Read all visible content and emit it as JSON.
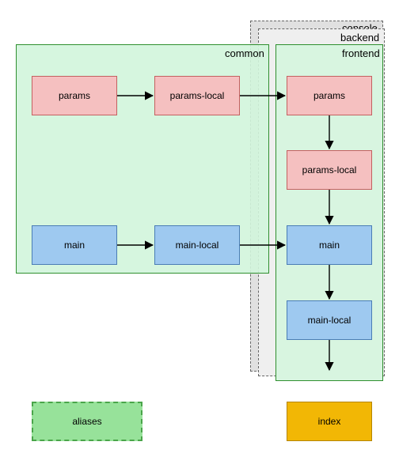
{
  "stack_labels": {
    "console": "console",
    "backend": "backend"
  },
  "containers": {
    "common": "common",
    "frontend": "frontend"
  },
  "common": {
    "params": "params",
    "params_local": "params-local",
    "main": "main",
    "main_local": "main-local"
  },
  "frontend": {
    "params": "params",
    "params_local": "params-local",
    "main": "main",
    "main_local": "main-local"
  },
  "footer": {
    "aliases": "aliases",
    "index": "index"
  },
  "chart_data": {
    "type": "diagram",
    "groups": [
      {
        "id": "common",
        "label": "common",
        "nodes": [
          "cp",
          "cpl",
          "cm",
          "cml"
        ]
      },
      {
        "id": "frontend",
        "label": "frontend",
        "nodes": [
          "fp",
          "fpl",
          "fm",
          "fml"
        ],
        "stacked_behind": [
          "backend",
          "console"
        ]
      }
    ],
    "nodes": [
      {
        "id": "cp",
        "label": "params",
        "group": "common",
        "type": "params"
      },
      {
        "id": "cpl",
        "label": "params-local",
        "group": "common",
        "type": "params"
      },
      {
        "id": "cm",
        "label": "main",
        "group": "common",
        "type": "main"
      },
      {
        "id": "cml",
        "label": "main-local",
        "group": "common",
        "type": "main"
      },
      {
        "id": "fp",
        "label": "params",
        "group": "frontend",
        "type": "params"
      },
      {
        "id": "fpl",
        "label": "params-local",
        "group": "frontend",
        "type": "params"
      },
      {
        "id": "fm",
        "label": "main",
        "group": "frontend",
        "type": "main"
      },
      {
        "id": "fml",
        "label": "main-local",
        "group": "frontend",
        "type": "main"
      },
      {
        "id": "aliases",
        "label": "aliases",
        "type": "footer"
      },
      {
        "id": "index",
        "label": "index",
        "type": "footer"
      }
    ],
    "edges": [
      [
        "cp",
        "cpl"
      ],
      [
        "cpl",
        "fp"
      ],
      [
        "cm",
        "cml"
      ],
      [
        "cml",
        "fm"
      ],
      [
        "fp",
        "fpl"
      ],
      [
        "fpl",
        "fm"
      ],
      [
        "fm",
        "fml"
      ],
      [
        "fml",
        "out"
      ]
    ]
  }
}
